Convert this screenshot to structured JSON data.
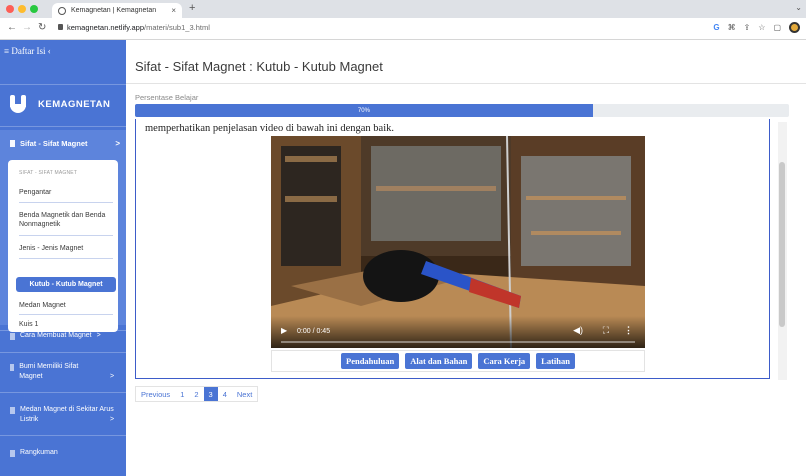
{
  "browser": {
    "tab_title": "Kemagnetan | Kemagnetan",
    "tab_close": "×",
    "new_tab": "+",
    "url_host": "kemagnetan.netlify.app",
    "url_path": "/materi/sub1_3.html",
    "traffic_colors": [
      "#fd5f57",
      "#febc2e",
      "#28c840"
    ]
  },
  "sidebar": {
    "toggle_label": "≡ Daftar Isi ‹",
    "brand": "KEMAGNETAN",
    "active_group": "Sifat - Sifat Magnet",
    "submenu_caption": "SIFAT - SIFAT MAGNET",
    "submenu_items": [
      "Pengantar",
      "Benda Magnetik dan Benda Nonmagnetik",
      "Jenis - Jenis Magnet",
      "Kutub - Kutub Magnet",
      "Medan Magnet",
      "Kuis 1"
    ],
    "other_groups": [
      "Cara Membuat Magnet",
      "Bumi Memiliki Sifat Magnet",
      "Medan Magnet di Sekitar Arus Listrik",
      "Rangkuman"
    ],
    "chevron": ">"
  },
  "main": {
    "title": "Sifat - Sifat Magnet : Kutub - Kutub Magnet",
    "progress_label": "Persentase Belajar",
    "progress_text": "70%",
    "progress_value": 0.7,
    "intro_text": "memperhatikan penjelasan video di bawah ini dengan baik.",
    "video_time": "0:00 / 0:45",
    "buttons": [
      "Pendahuluan",
      "Alat dan Bahan",
      "Cara Kerja",
      "Latihan"
    ],
    "pagination": {
      "prev": "Previous",
      "pages": [
        "1",
        "2",
        "3",
        "4"
      ],
      "current": "3",
      "next": "Next"
    }
  },
  "colors": {
    "primary": "#4a74d4",
    "frame": "#3d5cc9"
  }
}
